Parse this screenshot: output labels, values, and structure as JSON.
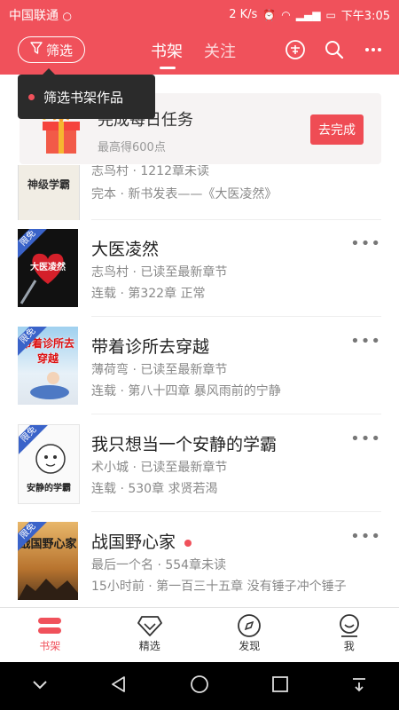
{
  "status_bar": {
    "carrier": "中国联通",
    "speed": "2 K/s",
    "time": "下午3:05"
  },
  "header": {
    "filter_label": "筛选",
    "tabs": [
      {
        "label": "书架",
        "active": true
      },
      {
        "label": "关注",
        "active": false
      }
    ],
    "icons": [
      "free-badge-icon",
      "search-icon",
      "more-icon"
    ]
  },
  "tooltip": {
    "text": "筛选书架作品"
  },
  "task": {
    "title": "完成每日任务",
    "subtitle": "最高得600点",
    "button": "去完成"
  },
  "partial_book": {
    "cover_text": "神级学霸",
    "line1": "志鸟村 · 1212章未读",
    "line2": "完本 · 新书发表——《大医凌然》"
  },
  "books": [
    {
      "title": "大医凌然",
      "line1": "志鸟村 · 已读至最新章节",
      "line2": "连载 · 第322章 正常",
      "cover_text": "大医凌然",
      "tag": "限免",
      "new": false
    },
    {
      "title": "带着诊所去穿越",
      "line1": "薄荷弯 · 已读至最新章节",
      "line2": "连载 · 第八十四章 暴风雨前的宁静",
      "cover_text": "带着诊所去穿越",
      "tag": "限免",
      "new": false
    },
    {
      "title": "我只想当一个安静的学霸",
      "line1": "术小城 · 已读至最新章节",
      "line2": "连载 · 530章 求贤若渴",
      "cover_text": "安静的学霸",
      "tag": "限免",
      "new": false
    },
    {
      "title": "战国野心家",
      "line1": "最后一个名 · 554章未读",
      "line2": "15小时前 · 第一百三十五章 没有锤子冲个锤子",
      "cover_text": "战国野心家",
      "tag": "限免",
      "new": true
    }
  ],
  "bottom_nav": [
    {
      "label": "书架",
      "icon": "bookshelf-icon",
      "active": true
    },
    {
      "label": "精选",
      "icon": "diamond-icon",
      "active": false
    },
    {
      "label": "发现",
      "icon": "compass-icon",
      "active": false
    },
    {
      "label": "我",
      "icon": "profile-icon",
      "active": false
    }
  ],
  "colors": {
    "accent": "#f0515b",
    "tag_blue": "#3a63c9"
  }
}
